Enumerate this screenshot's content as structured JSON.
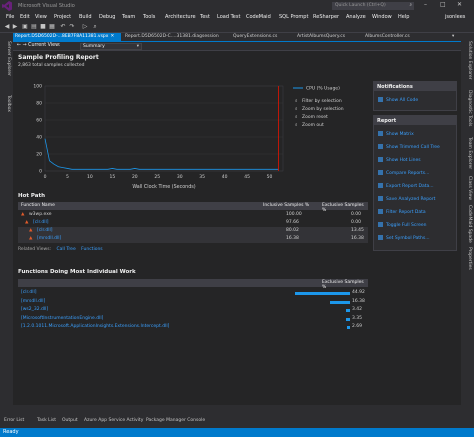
{
  "window": {
    "title": "Microsoft Visual Studio"
  },
  "quick_launch": {
    "placeholder": "Quick Launch (Ctrl+Q)"
  },
  "menu": [
    "File",
    "Edit",
    "View",
    "Project",
    "Build",
    "Debug",
    "Team",
    "Tools",
    "Architecture",
    "Test",
    "Load Test",
    "CodeMaid",
    "SQL Prompt",
    "ReSharper",
    "Analyze",
    "Window",
    "Help"
  ],
  "user": "jsonlees",
  "side_left_tabs": [
    "Server Explorer",
    "Toolbox"
  ],
  "side_right_tabs": [
    "Solution Explorer",
    "Diagnostic Tools",
    "Team Explorer",
    "Class View",
    "CodeMaid Spade",
    "Properties"
  ],
  "doc_tabs": [
    {
      "label": "Report.D5D6502D-...8EB7F8A11381.vspx",
      "active": true
    },
    {
      "label": "Report.D5D6502D-C....31381.diagsession",
      "active": false
    },
    {
      "label": "QueryExtensions.cs",
      "active": false
    },
    {
      "label": "ArtistAlbumsQuery.cs",
      "active": false
    },
    {
      "label": "AlbumsController.cs",
      "active": false
    }
  ],
  "view_bar": {
    "current_view_label": "Current View:",
    "current_view_value": "Summary"
  },
  "report": {
    "title": "Sample Profiling Report",
    "subtitle": "2,863 total samples collected"
  },
  "chart_data": {
    "type": "line",
    "xlabel": "Wall Clock Time (Seconds)",
    "ylabel": "",
    "xlim": [
      0,
      53
    ],
    "ylim": [
      0,
      100
    ],
    "x_ticks": [
      0,
      5,
      10,
      15,
      20,
      25,
      30,
      35,
      40,
      45,
      50
    ],
    "y_ticks": [
      0,
      20,
      40,
      60,
      80,
      100
    ],
    "series": [
      {
        "name": "CPU (% Usage)",
        "x": [
          0,
          1,
          2,
          3,
          4,
          5,
          6,
          7,
          8,
          9,
          10,
          11,
          12,
          13,
          14,
          15,
          16,
          17,
          18,
          19,
          20,
          21,
          22,
          23,
          24,
          25,
          26,
          27,
          28,
          29,
          30,
          31,
          32,
          33,
          34,
          35,
          36,
          37,
          38,
          39,
          40,
          41,
          42,
          43,
          44,
          45,
          46,
          47,
          48,
          49,
          50,
          51,
          52
        ],
        "y": [
          38,
          12,
          8,
          5,
          4,
          3,
          2,
          2,
          2,
          2,
          2,
          2,
          2,
          2,
          2,
          3,
          2,
          2,
          2,
          2,
          3,
          2,
          2,
          2,
          2,
          2,
          2,
          2,
          2,
          2,
          2,
          2,
          2,
          2,
          2,
          2,
          2,
          2,
          2,
          2,
          2,
          2,
          2,
          2,
          2,
          2,
          2,
          2,
          2,
          2,
          2,
          2,
          2
        ]
      }
    ],
    "selection_marker_x": 52,
    "legend": [
      "CPU (% Usage)"
    ],
    "controls": [
      "Filter by selection",
      "Zoom by selection",
      "Zoom reset",
      "Zoom out"
    ]
  },
  "hot_path": {
    "title": "Hot Path",
    "columns": [
      "Function Name",
      "Inclusive Samples %",
      "Exclusive Samples %"
    ],
    "rows": [
      {
        "name": "w3wp.exe",
        "inclusive": "100.00",
        "exclusive": "0.00",
        "link": false,
        "flame": true
      },
      {
        "name": "[clr.dll]",
        "inclusive": "97.66",
        "exclusive": "0.00",
        "link": true,
        "flame": true
      },
      {
        "name": "[clr.dll]",
        "inclusive": "80.02",
        "exclusive": "13.45",
        "link": true,
        "flame": true
      },
      {
        "name": "[mrsdll.dll]",
        "inclusive": "16.38",
        "exclusive": "16.38",
        "link": true,
        "flame": true
      }
    ],
    "related_label": "Related Views:",
    "related_links": [
      "Call Tree",
      "Functions"
    ]
  },
  "most_work": {
    "title": "Functions Doing Most Individual Work",
    "column": "Exclusive Samples %",
    "rows": [
      {
        "name": "[clr.dll]",
        "value": "44.92",
        "fraction": 0.4492
      },
      {
        "name": "[mrsdll.dll]",
        "value": "16.38",
        "fraction": 0.1638
      },
      {
        "name": "[ws2_32.dll]",
        "value": "3.42",
        "fraction": 0.0342
      },
      {
        "name": "[MicrosoftInstrumentationEngine.dll]",
        "value": "3.35",
        "fraction": 0.0335
      },
      {
        "name": "[1.2.0.1011.Microsoft.ApplicationInsights.Extensions.Intercept.dll]",
        "value": "2.69",
        "fraction": 0.0269
      }
    ]
  },
  "notifications": {
    "title": "Notifications",
    "items": [
      "Show All Code"
    ]
  },
  "report_panel": {
    "title": "Report",
    "items": [
      "Show Matrix",
      "Show Trimmed Call Tree",
      "Show Hot Lines",
      "Compare Reports...",
      "Export Report Data...",
      "Save Analyzed Report",
      "Filter Report Data",
      "Toggle Full Screen",
      "Set Symbol Paths..."
    ]
  },
  "bottom_tabs": [
    "Error List",
    "Task List",
    "Output",
    "Azure App Service Activity",
    "Package Manager Console"
  ],
  "status": "Ready",
  "colors": {
    "accent": "#007acc",
    "link": "#3aa0ff",
    "marker": "#e51400",
    "bar": "#1c97ea"
  }
}
